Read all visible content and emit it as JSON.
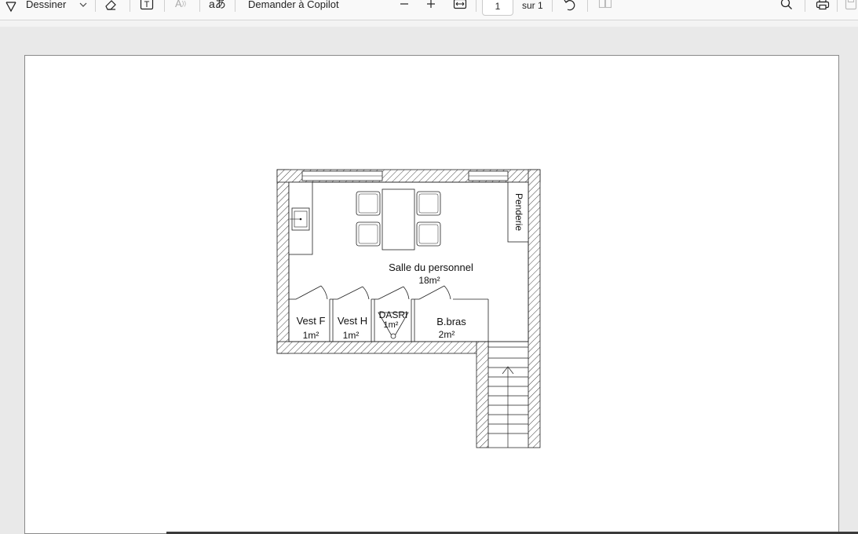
{
  "toolbar": {
    "draw_label": "Dessiner",
    "copilot_label": "Demander à Copilot",
    "translate_glyph": "aあ",
    "text_glyph": "T",
    "read_glyph": "A",
    "page_current": "1",
    "page_total": "sur 1",
    "icons": [
      "draw-icon",
      "chevron-down-icon",
      "eraser-icon",
      "text-box-icon",
      "read-aloud-icon",
      "translate-icon",
      "zoom-out-icon",
      "zoom-in-icon",
      "fit-width-icon",
      "rotate-icon",
      "page-view-icon",
      "search-icon",
      "print-icon",
      "save-icon"
    ]
  },
  "plan": {
    "main_room_name": "Salle du personnel",
    "main_room_area": "18m²",
    "wardrobe_label": "Penderie",
    "rooms": [
      {
        "name": "Vest F",
        "area": "1m²"
      },
      {
        "name": "Vest H",
        "area": "1m²"
      },
      {
        "name": "DASRI",
        "area": "1m²"
      },
      {
        "name": "B.bras",
        "area": "2m²"
      }
    ]
  }
}
